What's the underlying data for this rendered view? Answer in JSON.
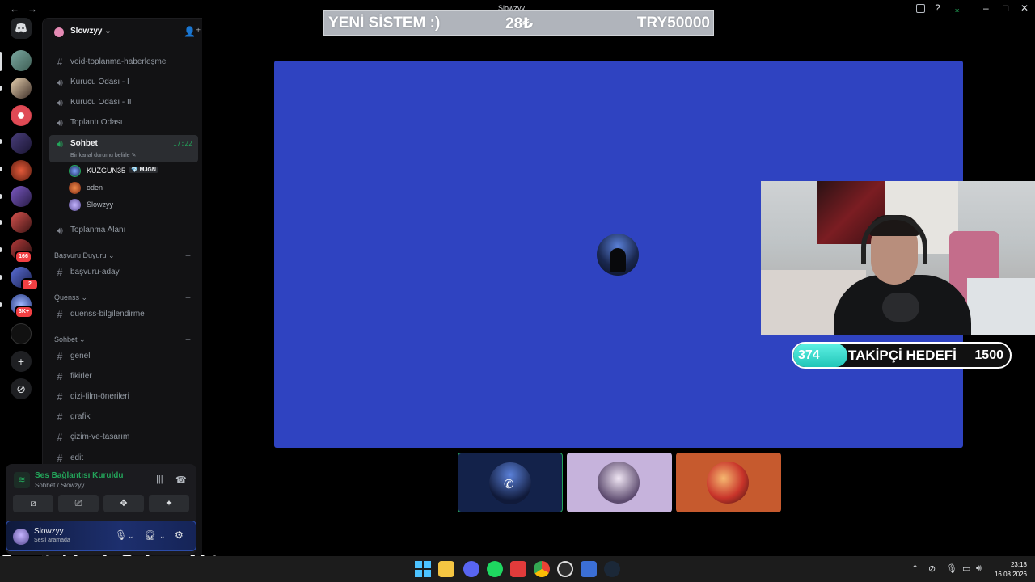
{
  "window": {
    "title": "Slowzyy"
  },
  "overlay_top": {
    "left": "YENİ SİSTEM :)",
    "middle": "28₺",
    "right": "TRY50000"
  },
  "rail": {
    "badges": [
      "166",
      "2",
      "3K+"
    ]
  },
  "guild": {
    "name": "Slowzyy ⌄"
  },
  "channels": {
    "top": [
      {
        "type": "text",
        "label": "void-toplanma-haberleşme"
      },
      {
        "type": "voice",
        "label": "Kurucu Odası - I"
      },
      {
        "type": "voice",
        "label": "Kurucu Odası - II"
      },
      {
        "type": "voice",
        "label": "Toplantı Odası"
      }
    ],
    "active": {
      "label": "Sohbet",
      "time": "17:22",
      "status": "Bir kanal durumu belirle ✎"
    },
    "voice_users": [
      {
        "name": "KUZGUN35",
        "tag": "💎 MJGN"
      },
      {
        "name": "oden"
      },
      {
        "name": "Slowzyy"
      }
    ],
    "after_active": {
      "label": "Toplanma Alanı"
    },
    "categories": [
      {
        "name": "Başvuru Duyuru ⌄",
        "channels": [
          "başvuru-aday"
        ]
      },
      {
        "name": "Quenss ⌄",
        "channels": [
          "quenss-bilgilendirme"
        ]
      },
      {
        "name": "Sohbet ⌄",
        "channels": [
          "genel",
          "fikirler",
          "dizi-film-önerileri",
          "grafik",
          "çizim-ve-tasarım",
          "edit"
        ]
      }
    ]
  },
  "voice_panel": {
    "status": "Ses Bağlantısı Kuruldu",
    "location": "Sohbet / Slowzyy"
  },
  "user": {
    "name": "Slowzyy",
    "status": "Sesli aramada"
  },
  "stream": {
    "goal": {
      "current": 374,
      "target": 1500,
      "label": "TAKİPÇİ HEDEFİ",
      "current_text": "374",
      "target_text": "1500"
    },
    "latest_follower": "Son takipçi: Sylus_Aktanw"
  },
  "taskbar": {
    "time": "23:18",
    "date": "16.08.2026"
  },
  "colors": {
    "stage": "#2f43c1",
    "speaking": "#23a55a",
    "goal_fill": "#21c6b8"
  }
}
